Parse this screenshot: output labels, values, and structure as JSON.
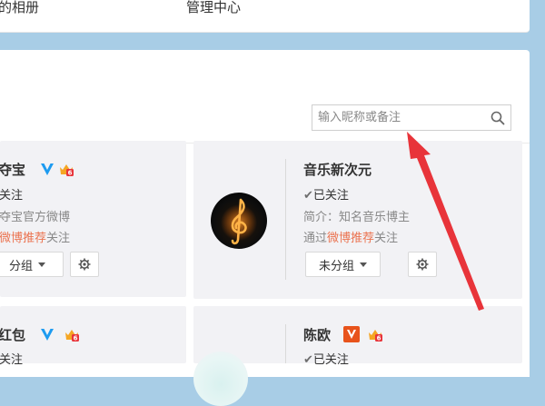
{
  "topnav": {
    "items": [
      "的相册",
      "管理中心"
    ]
  },
  "search": {
    "placeholder": "输入昵称或备注",
    "icon": "search-icon"
  },
  "cards": [
    {
      "name": "夺宝",
      "follow_status": "关注",
      "intro": "夺宝官方微博",
      "via_prefix": "",
      "via_link": "微博推荐",
      "via_suffix": "关注",
      "group_label": "分组"
    },
    {
      "name": "音乐新次元",
      "follow_status": "已关注",
      "intro": "简介：知名音乐博主",
      "via_prefix": "通过",
      "via_link": "微博推荐",
      "via_suffix": "关注",
      "group_label": "未分组",
      "avatar": "treble-clef-avatar"
    },
    {
      "name": "红包",
      "follow_status": "关注"
    },
    {
      "name": "陈欧",
      "follow_status": "已关注"
    }
  ],
  "colors": {
    "background": "#a8cde6",
    "card": "#f2f2f5",
    "highlight": "#eb7350",
    "verified_blue": "#1d9bf0",
    "verified_orange": "#f5a623",
    "annotation_arrow": "#e8343a"
  }
}
